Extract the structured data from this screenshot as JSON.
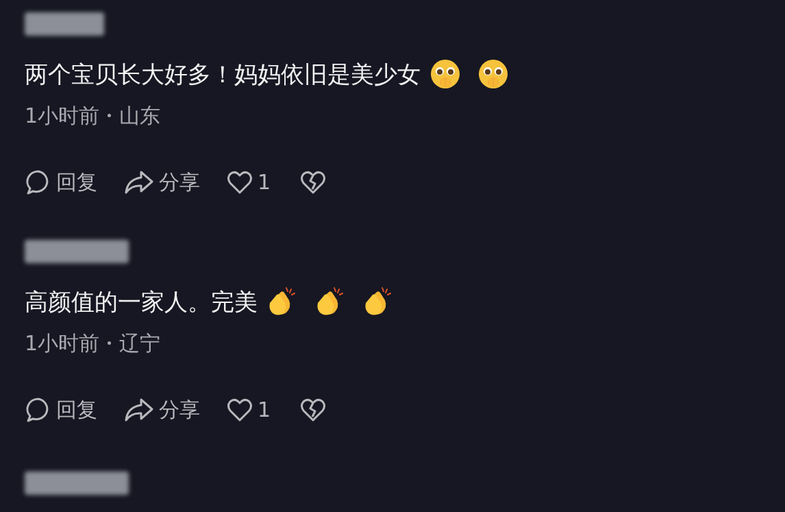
{
  "comments": [
    {
      "text": "两个宝贝长大好多！妈妈依旧是美少女",
      "kind": "full",
      "emojis": [
        {
          "kind": "pleading"
        },
        {
          "kind": "pleading"
        }
      ],
      "time": "1小时前",
      "location": "山东",
      "actions": {
        "reply": "回复",
        "share": "分享",
        "likes": "1"
      }
    },
    {
      "text": "高颜值的一家人。完美",
      "kind": "full",
      "emojis": [
        {
          "kind": "clap"
        },
        {
          "kind": "clap"
        },
        {
          "kind": "clap"
        }
      ],
      "time": "1小时前",
      "location": "辽宁",
      "actions": {
        "reply": "回复",
        "share": "分享",
        "likes": "1"
      }
    },
    {
      "kind": "cut_off"
    }
  ]
}
